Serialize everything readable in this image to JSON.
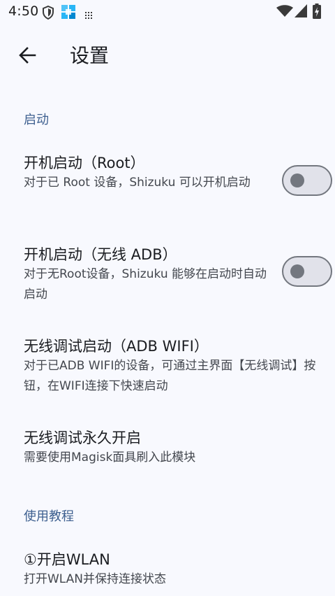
{
  "status_bar": {
    "time": "4:50",
    "left_icons": [
      "shield-icon",
      "app-store-icon",
      "grid-icon"
    ],
    "right_icons": [
      "wifi-icon",
      "signal-icon",
      "battery-charging-icon"
    ]
  },
  "toolbar": {
    "title": "设置",
    "back_icon": "arrow-left-icon"
  },
  "sections": [
    {
      "header": "启动"
    },
    {
      "header": "使用教程"
    }
  ],
  "prefs": [
    {
      "title": "开机启动（Root）",
      "summary": "对于已 Root 设备，Shizuku 可以开机启动",
      "has_switch": true,
      "switch_on": false
    },
    {
      "title": "开机启动（无线 ADB）",
      "summary": "对于无Root设备，Shizuku 能够在启动时自动启动",
      "has_switch": true,
      "switch_on": false
    },
    {
      "title": "无线调试启动（ADB WIFI）",
      "summary": "对于已ADB WIFI的设备，可通过主界面【无线调试】按钮，在WIFI连接下快速启动",
      "has_switch": false
    },
    {
      "title": "无线调试永久开启",
      "summary": "需要使用Magisk面具刷入此模块",
      "has_switch": false
    },
    {
      "title": "①开启WLAN",
      "summary": "打开WLAN并保持连接状态",
      "has_switch": false
    }
  ],
  "colors": {
    "background": "#f8f9fe",
    "section_header": "#3d5f8f",
    "switch_outline": "#73777f"
  }
}
